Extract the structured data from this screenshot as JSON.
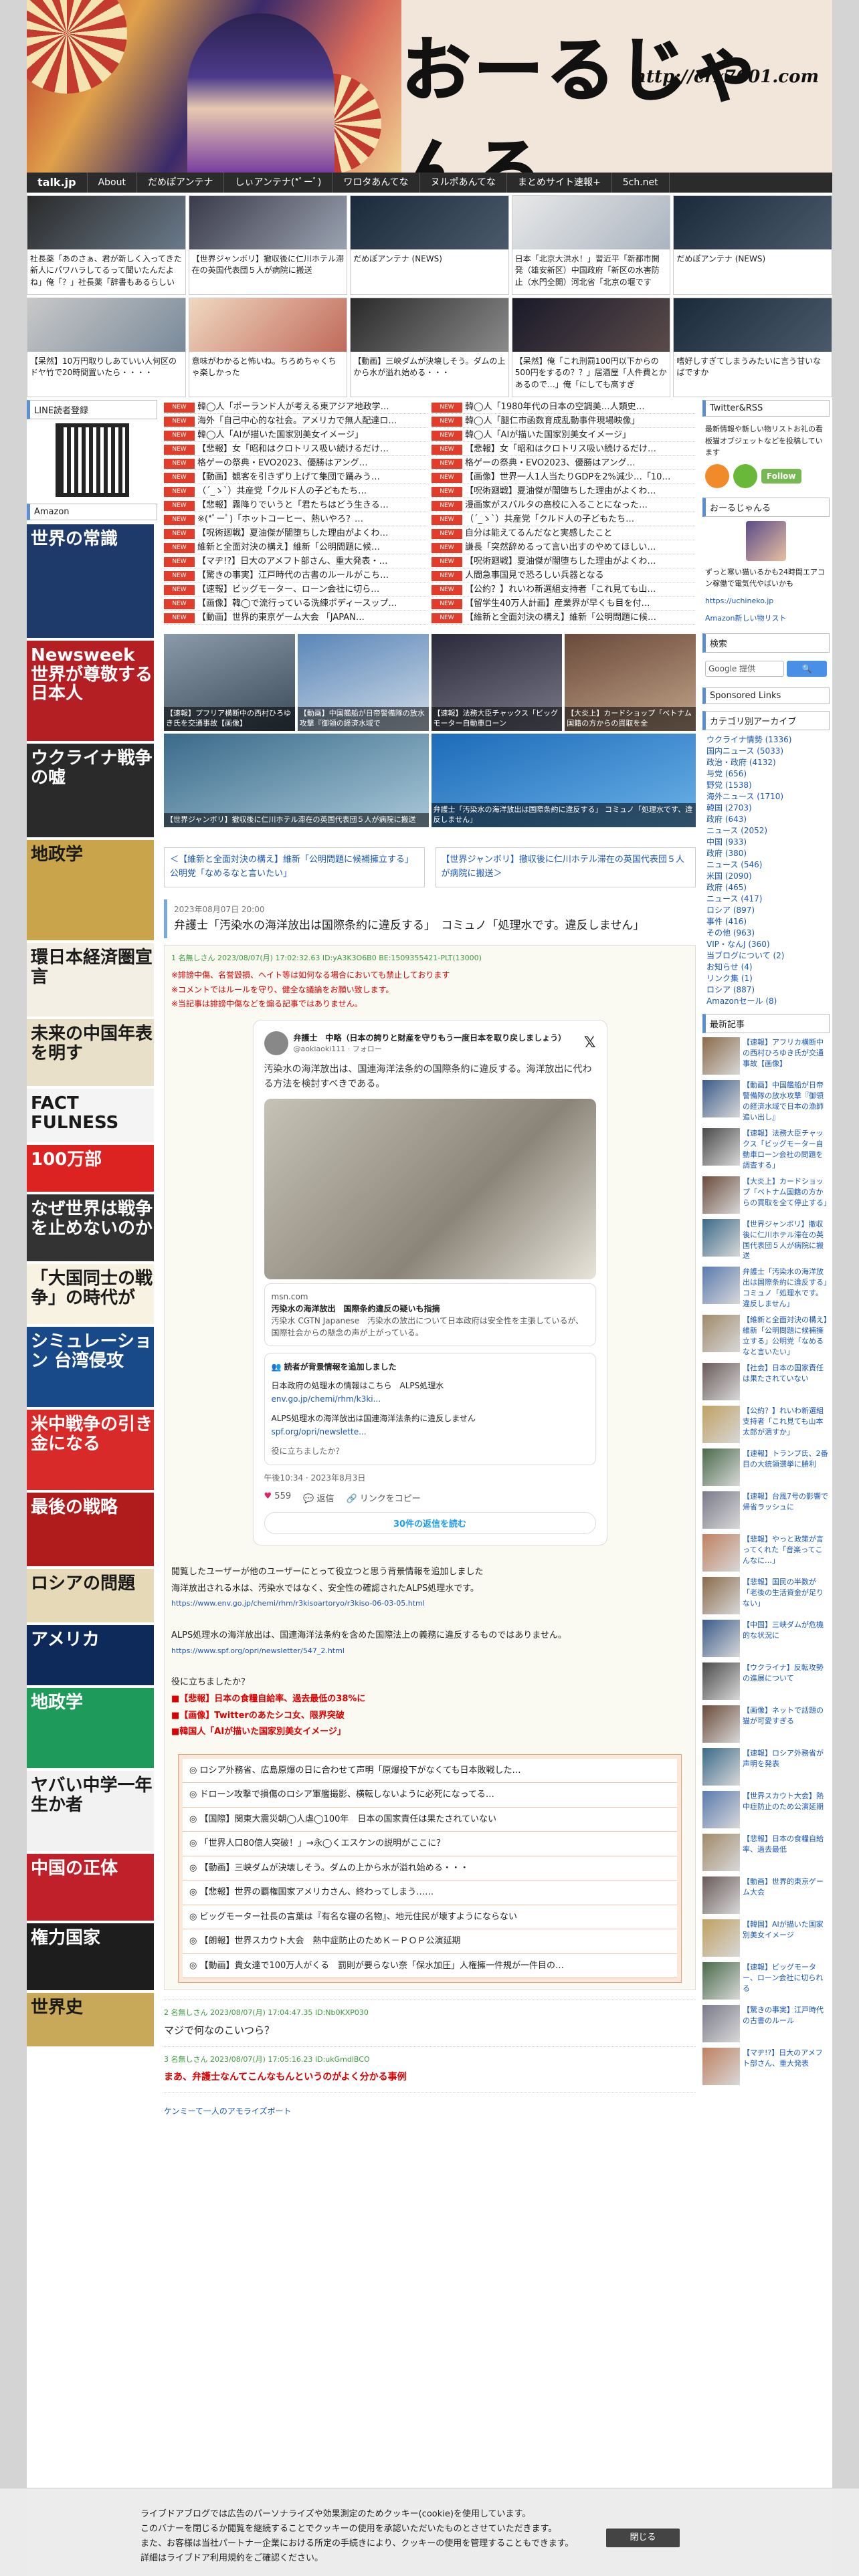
{
  "header": {
    "title": "おーるじゃんる",
    "url": "http://crx7601.com"
  },
  "nav": [
    "talk.jp",
    "About",
    "だめぽアンテナ",
    "しぃアンテナ(*ﾟーﾟ)",
    "ワロタあんてな",
    "ヌルポあんてな",
    "まとめサイト速報+",
    "5ch.net"
  ],
  "thumbs": [
    "社長薬「あのさぁ、君が新しく入ってきた新人にパワハラしてるって聞いたんだよね」俺「？」社長薬「辞書もあるらしい",
    "【世界ジャンボリ】撤収後に仁川ホテル滞在の英国代表団５人が病院に搬送",
    "だめぽアンテナ (NEWS)",
    "日本「北京大洪水！」習近平「新都市開発（雄安新区）中国政府「新区の水害防止（水門全開）河北省「北京の堰です",
    "だめぽアンテナ (NEWS)",
    "【呆然】10万円取りしあていい人何区のドヤ竹で20時間置いたら・・・・",
    "意味がわかると怖いね。ちろめちゃくちゃ楽しかった",
    "【動画】三峡ダムが決壊しそう。ダムの上から水が溢れ始める・・・",
    "【呆然】俺「これ刑罰100円以下からの500円をするの？？」居酒屋「人件費とかあるので…」俺「にしても高すぎ",
    "嗜好しすぎてしまうみたいに言う甘いなばですか"
  ],
  "left": {
    "line_title": "LINE読者登録",
    "amazon_title": "Amazon",
    "books": [
      {
        "t": "世界の常識",
        "c": "#1e3a6a"
      },
      {
        "t": "Newsweek 世界が尊敬する日本人",
        "c": "#b41f24"
      },
      {
        "t": "ウクライナ戦争の嘘",
        "c": "#2a2a2a"
      },
      {
        "t": "地政学",
        "c": "#c9a44a"
      },
      {
        "t": "環日本経済圏宣言",
        "c": "#f3efe5"
      },
      {
        "t": "未来の中国年表を明す",
        "c": "#e8e0c8"
      },
      {
        "t": "FACT FULNESS",
        "c": "#f4f4f4"
      },
      {
        "t": "100万部",
        "c": "#d22"
      },
      {
        "t": "なぜ世界は戦争を止めないのか",
        "c": "#333"
      },
      {
        "t": "「大国同士の戦争」の時代が",
        "c": "#f7f2e2"
      },
      {
        "t": "シミュレーション 台湾侵攻",
        "c": "#184a8a"
      },
      {
        "t": "米中戦争の引き金になる",
        "c": "#d92a2a"
      },
      {
        "t": "最後の戦略",
        "c": "#b01c1c"
      },
      {
        "t": "ロシアの問題",
        "c": "#e6d9b8"
      },
      {
        "t": "アメリカ",
        "c": "#0d2a5a"
      },
      {
        "t": "地政学",
        "c": "#1e9a5a"
      },
      {
        "t": "ヤバい中学一年生か者",
        "c": "#f2f2f2"
      },
      {
        "t": "中国の正体",
        "c": "#c0202a"
      },
      {
        "t": "権力国家",
        "c": "#1d1d1d"
      },
      {
        "t": "世界史",
        "c": "#c8a95a"
      }
    ]
  },
  "heads_left": [
    "韓◯人「ポーランド人が考える東アジア地政学…",
    "海外「自己中心的な社会。アメリカで無人配達ロ…",
    "韓◯人「AIが描いた国家別美女イメージ」",
    "【悲報】女「昭和はクロトリス吸い続けるだけ…",
    "格ゲーの祭典・EVO2023、優勝はアング…",
    "【動画】観客を引きずり上げて集団で踊みう…",
    "（´_ゝ`）共産党「クルド人の子どもたち…",
    "【悲報】霧降りでいうと「君たちはどう生きる…",
    "※(*ﾟーﾟ)「ホットコーヒー、熱いやろ？…",
    "【呪術廻戦】夏油傑が闇堕ちした理由がよくわ…",
    "維新と全面対決の構え】維新「公明問題に候…",
    "【マヂ!?】日大のアメフト部さん、重大発表・…",
    "【驚きの事実】江戸時代の古書のルールがこち…",
    "【速報】ビッグモーター、ローン会社に切ら…",
    "【画像】韓◯で流行っている洗練ポディースップ…",
    "【動画】世界的東京ゲーム大会 「JAPAN…"
  ],
  "heads_right": [
    "韓◯人「1980年代の日本の空調美…人類史…",
    "韓◯人「腿仁市函数育成乱動事件現場映像」",
    "韓◯人「AIが描いた国家別美女イメージ」",
    "【悲報】女「昭和はクロトリス吸い続けるだけ…",
    "格ゲーの祭典・EVO2023、優勝はアング…",
    "【画像】世界一人1人当たりGDPを2%減少…「10…",
    "【呪術廻戦】夏油傑が闇堕ちした理由がよくわ…",
    "漫画家がスパルタの高校に入ることになった…",
    "（´_ゝ`）共産党「クルド人の子どもたち…",
    "自分は能えてるんだなと実感したこと",
    "謙長「突然辞めるって言い出すのやめてほしい…",
    "【呪術廻戦】夏油傑が闇堕ちした理由がよくわ…",
    "人間急事国見で恐ろしい兵器となる",
    "【公約？】れいわ新選組支持者「これ見ても山…",
    "【留学生40万人計画】産業界が早くも目を付…",
    "【維新と全面対決の構え】維新「公明問題に候…"
  ],
  "tag": "NEW",
  "pics": [
    {
      "cap": "【速報】プフリア横断中の西村ひろゆき氏を交通事故【画像】",
      "c1": "#8a9aa8",
      "c2": "#3a4a58"
    },
    {
      "cap": "【動画】中国艦船が日帝警備隊の放水攻撃『御領の経済水域で",
      "c1": "#5a86b8",
      "c2": "#d0dce8"
    },
    {
      "cap": "【速報】法務大臣チャックス「ビッグモーター自動車ローン",
      "c1": "#2a2a3a",
      "c2": "#7a7a8a"
    },
    {
      "cap": "【大炎上】カードショップ「ベトナム国籍の方からの買取を全",
      "c1": "#6a4a3a",
      "c2": "#c2a48a"
    }
  ],
  "pics2": [
    {
      "cap": "【世界ジャンボリ】撤収後に仁川ホテル滞在の英国代表団５人が病院に搬送",
      "c1": "#3a6a8a",
      "c2": "#a8c8d8"
    },
    {
      "cap": "弁護士「汚染水の海洋放出は国際条約に違反する」 コミュノ「処理水です、違反しません」",
      "c1": "#1d6ab8",
      "c2": "#6ab2e8"
    }
  ],
  "prev_link": "＜【維新と全面対決の構え】維新「公明問題に候補擁立する」公明党「なめるなと言いたい」",
  "next_link": "【世界ジャンボリ】撤収後に仁川ホテル滞在の英国代表団５人が病院に搬送＞",
  "article": {
    "date": "2023年08月07日 20:00",
    "title": "弁護士「汚染水の海洋放出は国際条約に違反する」　コミュノ「処理水です。違反しません」",
    "meta": "1 名無しさん 2023/08/07(月) 17:02:32.63 ID:yA3K3O6B0 BE:1509355421-PLT(13000)",
    "warn1": "※誹謗中傷、名誉毀損、ヘイト等は如何なる場合においても禁止しております",
    "warn2": "※コメントではルールを守り、健全な議論をお願い致します。",
    "warn3": "※当記事は誹謗中傷などを煽る記事ではありません。"
  },
  "tweet": {
    "name": "弁護士　中略（日本の誇りと財産を守りもう一度日本を取り戻しましょう）",
    "handle": "@aokiaoki111 · フォロー",
    "text": "汚染水の海洋放出は、国連海洋法条約の国際条約に違反する。海洋放出に代わる方法を検討すべきである。",
    "link_domain": "msn.com",
    "link_title": "汚染水の海洋放出　国際条約違反の疑いも指摘",
    "link_text": "汚染水 CGTN Japanese　汚染水の放出について日本政府は安全性を主張しているが、国際社会からの懸念の声が上がっている。",
    "note_head": "読者が背景情報を追加しました",
    "note1": "日本政府の処理水の情報はこちら　ALPS処理水",
    "note1_link": "env.go.jp/chemi/rhm/k3ki...",
    "note2": "ALPS処理水の海洋放出は国連海洋法条約に違反しません",
    "note2_link": "spf.org/opri/newslette...",
    "note_foot": "役に立ちましたか？",
    "time": "午後10:34 · 2023年8月3日",
    "likes": "559",
    "replies": "返信",
    "share": "リンクをコピー",
    "more": "30件の返信を読む"
  },
  "body": {
    "p1": "閲覧したユーザーが他のユーザーにとって役立つと思う背景情報を追加しました",
    "p2": "海洋放出される水は、汚染水ではなく、安全性の確認されたALPS処理水です。",
    "l1": "https://www.env.go.jp/chemi/rhm/r3kisoartoryo/r3kiso-06-03-05.html",
    "p3": "ALPS処理水の海洋放出は、国連海洋法条約を含めた国際法上の義務に違反するものではありません。",
    "l2": "https://www.spf.org/opri/newsletter/547_2.html",
    "p4": "役に立ちましたか？",
    "r1": "■【悲報】日本の食糧自給率、過去最低の38%に",
    "r2": "■【画像】Twitterのあたシコ女、限界突破",
    "r3": "■韓国人「AIが描いた国家別美女イメージ」"
  },
  "related": [
    "ロシア外務省、広島原爆の日に合わせて声明「原爆投下がなくても日本敗戦した…",
    "ドローン攻撃で損傷のロシア軍艦撮影、横転しないように必死になってる…",
    "【国際】関東大震災朝◯人虐◯100年　日本の国家責任は果たされていない",
    "「世界人口80億人突破！」→永◯くエスケンの説明がここに？",
    "【動画】三峡ダムが決壊しそう。ダムの上から水が溢れ始める・・・",
    "【悲報】世界の覇権国家アメリカさん、終わってしまう……",
    "ビッグモーター社長の言葉は『有名な寝の名物』、地元住民が壊すようにならない",
    "【朗報】世界スカウト大会　熱中症防止のためＫ－ＰＯＰ公演延期",
    "【動画】貴女達で100万人がくる　罰則が要らない奈「保水加圧」人権擁一件規が一件目の…"
  ],
  "comments": [
    {
      "m": "2 名無しさん 2023/08/07(月) 17:04:47.35 ID:Nb0KXP030",
      "b": "マジで何なのこいつら？"
    },
    {
      "m": "3 名無しさん 2023/08/07(月) 17:05:16.23 ID:ukGmdlBCO",
      "b": "まあ、弁護士なんてこんなもんというのがよく分かる事例"
    },
    {
      "m": "",
      "b": "ケンミーて一人のアモライズボート"
    }
  ],
  "right": {
    "tw_title": "Twitter&RSS",
    "tw_text": "最新情報や新しい物リストお礼の看板猫オブジェットなどを投稿しています",
    "follow": "Follow",
    "about_title": "おーるじゃんる",
    "about_text": "ずっと寒い猫いるかも24時間エアコン稼働で電気代やばいかも",
    "about_url": "https://uchineko.jp",
    "about_note": "Amazon新しい物リスト",
    "search_title": "検索",
    "search_ph": "Google 提供",
    "search_btn": "検索",
    "links_title": "Sponsored Links",
    "cat_title": "カテゴリ別アーカイブ",
    "cats": [
      "ウクライナ情勢 (1336)",
      "国内ニュース (5033)",
      "政治・政府 (4132)",
      "与党 (656)",
      "野党 (1538)",
      "海外ニュース (1710)",
      "韓国 (2703)",
      "政府 (643)",
      "ニュース (2052)",
      "中国 (933)",
      "政府 (380)",
      "ニュース (546)",
      "米国 (2090)",
      "政府 (465)",
      "ニュース (417)",
      "ロシア (897)",
      "事件 (416)",
      "その他 (963)",
      "VIP・なんJ (360)",
      "当ブログについて (2)",
      "お知らせ (4)",
      "リンク集 (1)",
      "ロシア (887)",
      "Amazonセール (8)"
    ],
    "new_title": "最新記事",
    "news": [
      "【速報】アフリカ横断中の西村ひろゆき氏が交通事故【画像】",
      "【動画】中国艦船が日帝警備隊の放水攻撃『御領の経済水域で日本の漁師追い出し』",
      "【速報】法務大臣チャックス「ビッグモーター自動車ローン会社の問題を調査する」",
      "【大炎上】カードショップ「ベトナム国籍の方からの買取を全て停止する」",
      "【世界ジャンボリ】撤収後に仁川ホテル滞在の英国代表団５人が病院に搬送",
      "弁護士「汚染水の海洋放出は国際条約に違反する」コミュノ「処理水です。違反しません」",
      "【維新と全面対決の構え】維新「公明問題に候補擁立する」公明党「なめるなと言いたい」",
      "【社会】日本の国家責任は果たされていない",
      "【公約？】れいわ新選組支持者「これ見ても山本太郎が潰すか」",
      "【速報】トランプ氏、2番目の大統領選挙に勝利",
      "【速報】台風7号の影響で帰省ラッシュに",
      "【悲報】やっと政策が言ってくれた「音楽ってこんなに…」",
      "【悲報】国民の半数が「老後の生活資金が足りない」",
      "【中国】三峡ダムが危機的な状況に",
      "【ウクライナ】反転攻勢の進展について",
      "【画像】ネットで話題の猫が可愛すぎる",
      "【速報】ロシア外務省が声明を発表",
      "【世界スカウト大会】熱中症防止のため公演延期",
      "【悲報】日本の食糧自給率、過去最低",
      "【動画】世界的東京ゲーム大会",
      "【韓国】AIが描いた国家別美女イメージ",
      "【速報】ビッグモーター、ローン会社に切られる",
      "【驚きの事実】江戸時代の古書のルール",
      "【マヂ!?】日大のアメフト部さん、重大発表"
    ]
  },
  "cookie": {
    "text1": "ライブドアブログでは広告のパーソナライズや効果測定のためクッキー(cookie)を使用しています。",
    "text2": "このバナーを閉じるか閲覧を継続することでクッキーの使用を承認いただいたものとさせていただきます。",
    "text3": "また、お客様は当社パートナー企業における所定の手続きにより、クッキーの使用を管理することもできます。",
    "text4": "詳細はライブドア利用規約をご確認ください。",
    "close": "閉じる"
  }
}
